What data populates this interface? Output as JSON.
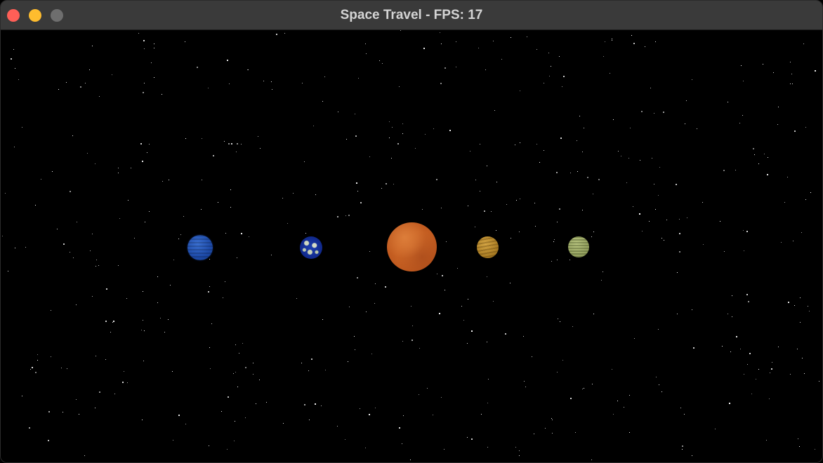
{
  "window": {
    "title": "Space Travel - FPS: 17"
  },
  "colors": {
    "titlebar": "#3a3a3a",
    "close": "#ff5f57",
    "minimize": "#febc2e",
    "maximize": "#6e6e6e",
    "background": "#000000"
  },
  "planets": [
    {
      "name": "blue-planet",
      "color": "#1d4aa8"
    },
    {
      "name": "earth-planet",
      "color": "#10288a"
    },
    {
      "name": "orange-planet",
      "color": "#c05a1f"
    },
    {
      "name": "gold-planet",
      "color": "#a77a22"
    },
    {
      "name": "green-planet",
      "color": "#8f9c5a"
    }
  ]
}
